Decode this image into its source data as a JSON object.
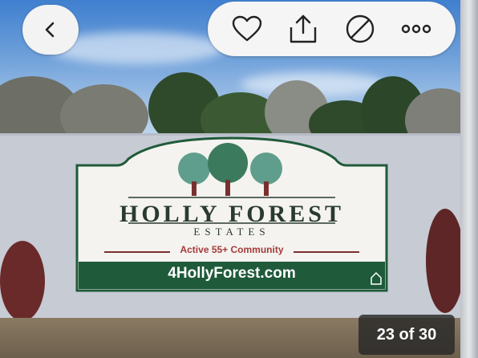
{
  "toolbar": {
    "back_icon": "chevron-left-icon",
    "actions": [
      {
        "icon": "heart-icon"
      },
      {
        "icon": "share-icon"
      },
      {
        "icon": "block-icon"
      },
      {
        "icon": "more-icon"
      }
    ]
  },
  "photo": {
    "sign_title": "HOLLY FOREST",
    "sign_subtitle": "ESTATES",
    "sign_tagline": "Active 55+ Community",
    "sign_url": "4HollyForest.com"
  },
  "gallery": {
    "counter": "23 of 30"
  },
  "colors": {
    "sign_green": "#1f5a3a",
    "sign_tag": "#a43b3b",
    "button_bg": "#f5f5f5",
    "counter_bg": "#282828"
  }
}
